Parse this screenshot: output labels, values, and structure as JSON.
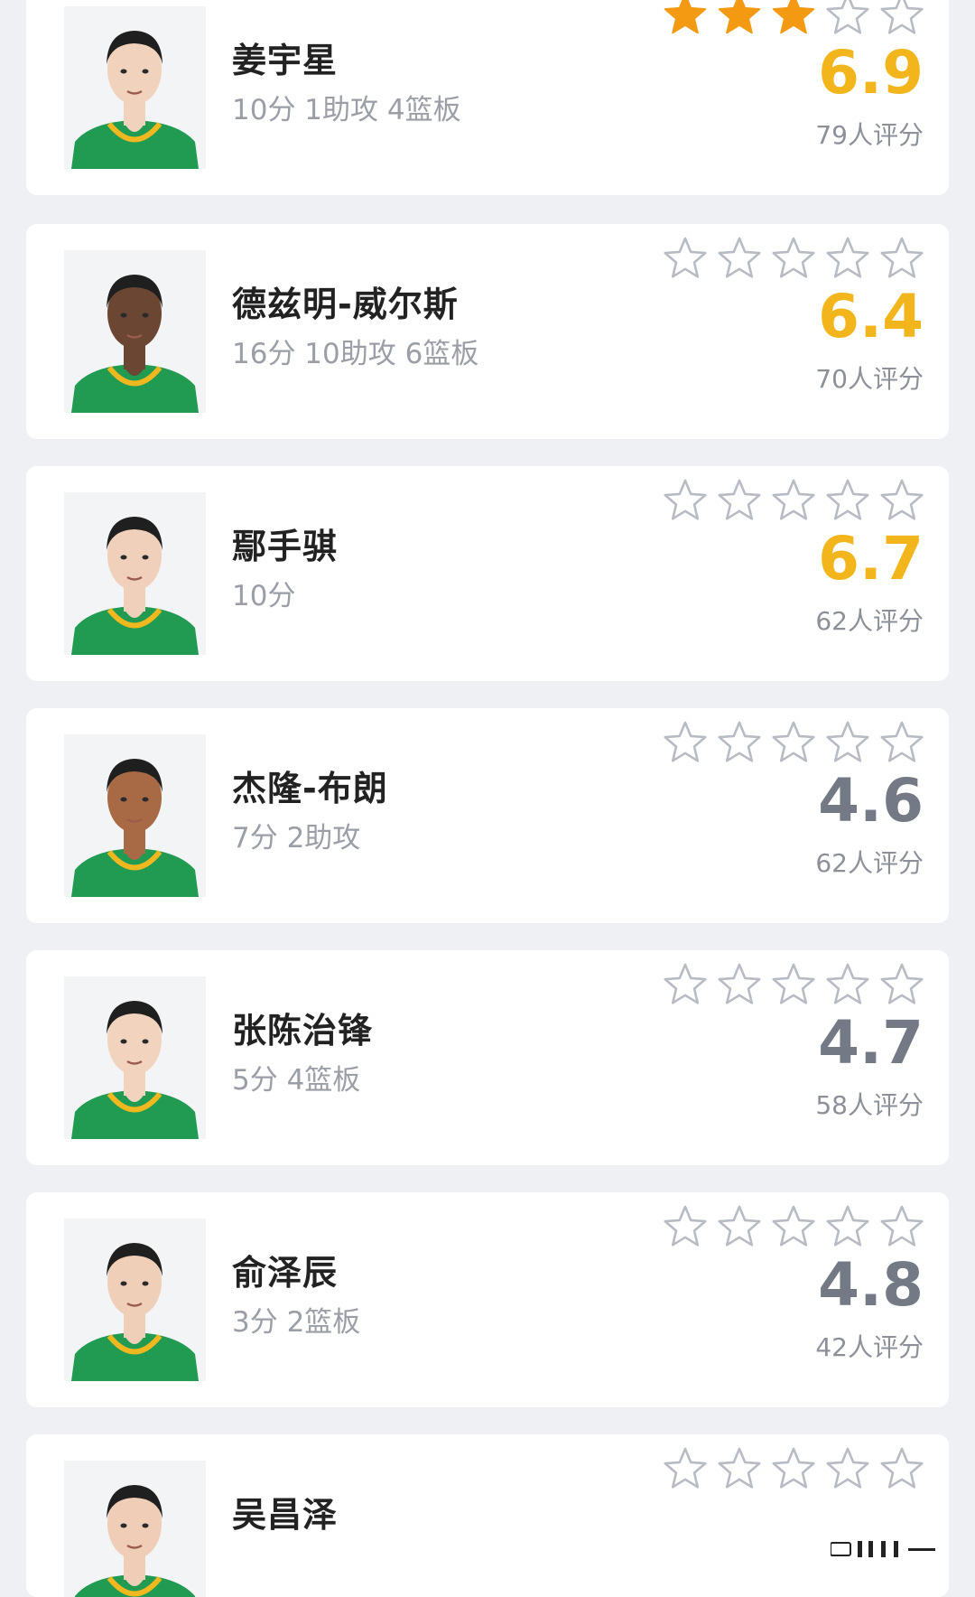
{
  "colors": {
    "page_background": "#eef0f3",
    "card_background": "#ffffff",
    "star_filled": "#f39a12",
    "star_outline": "#b7bcc4",
    "score_high": "#f2b51b",
    "score_low": "#737a85",
    "jersey_green": "#219a52",
    "jersey_trim": "#f0b71f"
  },
  "icons": {
    "star_filled": "filled-star-icon",
    "star_outline": "outline-star-icon",
    "avatar": "player-portrait-icon"
  },
  "players": [
    {
      "name": "姜宇星",
      "stats": "10分 1助攻 4篮板",
      "score": "6.9",
      "score_level": "high",
      "filled_stars": 3,
      "total_stars": 5,
      "rating_count": "79人评分"
    },
    {
      "name": "德兹明-威尔斯",
      "stats": "16分 10助攻 6篮板",
      "score": "6.4",
      "score_level": "high",
      "filled_stars": 0,
      "total_stars": 5,
      "rating_count": "70人评分"
    },
    {
      "name": "鄢手骐",
      "stats": "10分",
      "score": "6.7",
      "score_level": "high",
      "filled_stars": 0,
      "total_stars": 5,
      "rating_count": "62人评分"
    },
    {
      "name": "杰隆-布朗",
      "stats": "7分 2助攻",
      "score": "4.6",
      "score_level": "low",
      "filled_stars": 0,
      "total_stars": 5,
      "rating_count": "62人评分"
    },
    {
      "name": "张陈治锋",
      "stats": "5分 4篮板",
      "score": "4.7",
      "score_level": "low",
      "filled_stars": 0,
      "total_stars": 5,
      "rating_count": "58人评分"
    },
    {
      "name": "俞泽辰",
      "stats": "3分 2篮板",
      "score": "4.8",
      "score_level": "low",
      "filled_stars": 0,
      "total_stars": 5,
      "rating_count": "42人评分"
    },
    {
      "name": "吴昌泽",
      "stats": "",
      "score": "",
      "score_level": "low",
      "filled_stars": 0,
      "total_stars": 5,
      "rating_count": ""
    }
  ]
}
